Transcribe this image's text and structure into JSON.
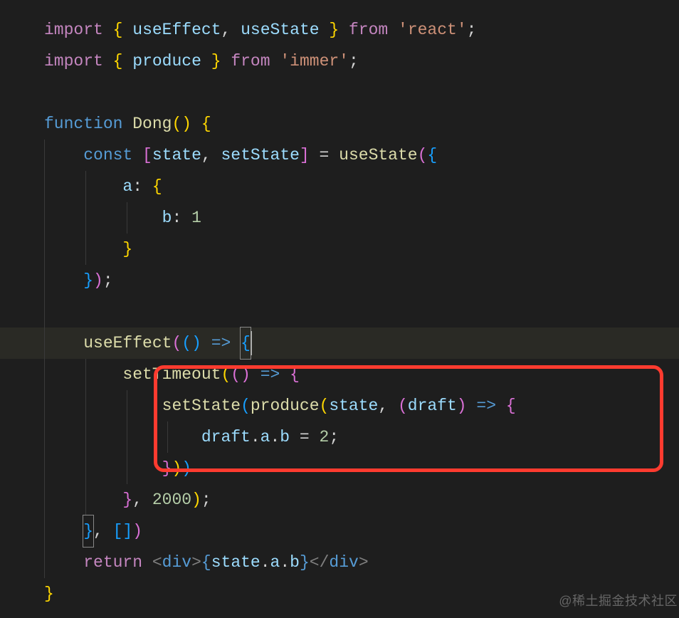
{
  "watermark": "@稀土掘金技术社区",
  "code": {
    "l1": {
      "import": "import",
      "lb": "{",
      "ids": "useEffect",
      "comma": ",",
      "id2": "useState",
      "rb": "}",
      "from": "from",
      "pkg": "'react'",
      "semi": ";"
    },
    "l2": {
      "import": "import",
      "lb": "{",
      "ids": "produce",
      "rb": "}",
      "from": "from",
      "pkg": "'immer'",
      "semi": ";"
    },
    "l4": {
      "kw": "function",
      "name": "Dong",
      "paren": "()",
      "brace": "{"
    },
    "l5": {
      "kw": "const",
      "lb": "[",
      "v1": "state",
      "comma": ",",
      "v2": "setState",
      "rb": "]",
      "eq": "=",
      "fn": "useState",
      "lp": "(",
      "lbrace": "{"
    },
    "l6": {
      "key": "a",
      "colon": ":",
      "brace": "{"
    },
    "l7": {
      "key": "b",
      "colon": ":",
      "val": "1"
    },
    "l8": {
      "brace": "}"
    },
    "l9": {
      "rbrace": "}",
      "rparen": ")",
      "semi": ";"
    },
    "l11": {
      "fn": "useEffect",
      "lp": "(",
      "paren": "()",
      "arrow": "=>",
      "brace": "{"
    },
    "l12": {
      "fn": "setTimeout",
      "lp": "(",
      "paren": "()",
      "arrow": "=>",
      "brace": "{"
    },
    "l13": {
      "fn1": "setState",
      "lp1": "(",
      "fn2": "produce",
      "lp2": "(",
      "arg1": "state",
      "comma": ",",
      "lp3": "(",
      "param": "draft",
      "rp3": ")",
      "arrow": "=>",
      "brace": "{"
    },
    "l14": {
      "obj": "draft",
      "dot1": ".",
      "p1": "a",
      "dot2": ".",
      "p2": "b",
      "eq": "=",
      "val": "2",
      "semi": ";"
    },
    "l15": {
      "rbrace": "}",
      "rp2": ")",
      "rp1": ")"
    },
    "l16": {
      "rbrace": "}",
      "comma": ",",
      "timeout": "2000",
      "rp": ")",
      "semi": ";"
    },
    "l17": {
      "rbrace": "}",
      "comma": ",",
      "lb": "[",
      "rb": "]",
      "rp": ")"
    },
    "l18": {
      "ret": "return",
      "lt1": "<",
      "tag1": "div",
      "gt1": ">",
      "jlb": "{",
      "obj": "state",
      "d1": ".",
      "p1": "a",
      "d2": ".",
      "p2": "b",
      "jrb": "}",
      "lt2": "</",
      "tag2": "div",
      "gt2": ">"
    },
    "l19": {
      "brace": "}"
    }
  }
}
